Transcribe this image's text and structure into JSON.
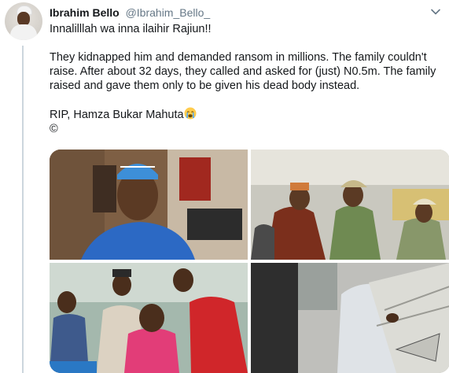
{
  "author": {
    "name": "Ibrahim Bello",
    "handle": "@Ibrahim_Bello_"
  },
  "tweet": {
    "line1": "Innalilllah wa inna ilaihir Rajiun!!",
    "para2_line1": "They kidnapped him and demanded ransom in millions. The family couldn't",
    "para2_line2": "raise. After about 32 days, they called and asked for (just) N0.5m. The family",
    "para2_line3": "raised and gave them only to be given his dead body instead.",
    "rip": "RIP, Hamza Bukar Mahuta",
    "copyright": "©"
  },
  "icons": {
    "more": "chevron-down-icon",
    "emoji": "loudly-crying-face"
  },
  "media": {
    "count": 4
  }
}
